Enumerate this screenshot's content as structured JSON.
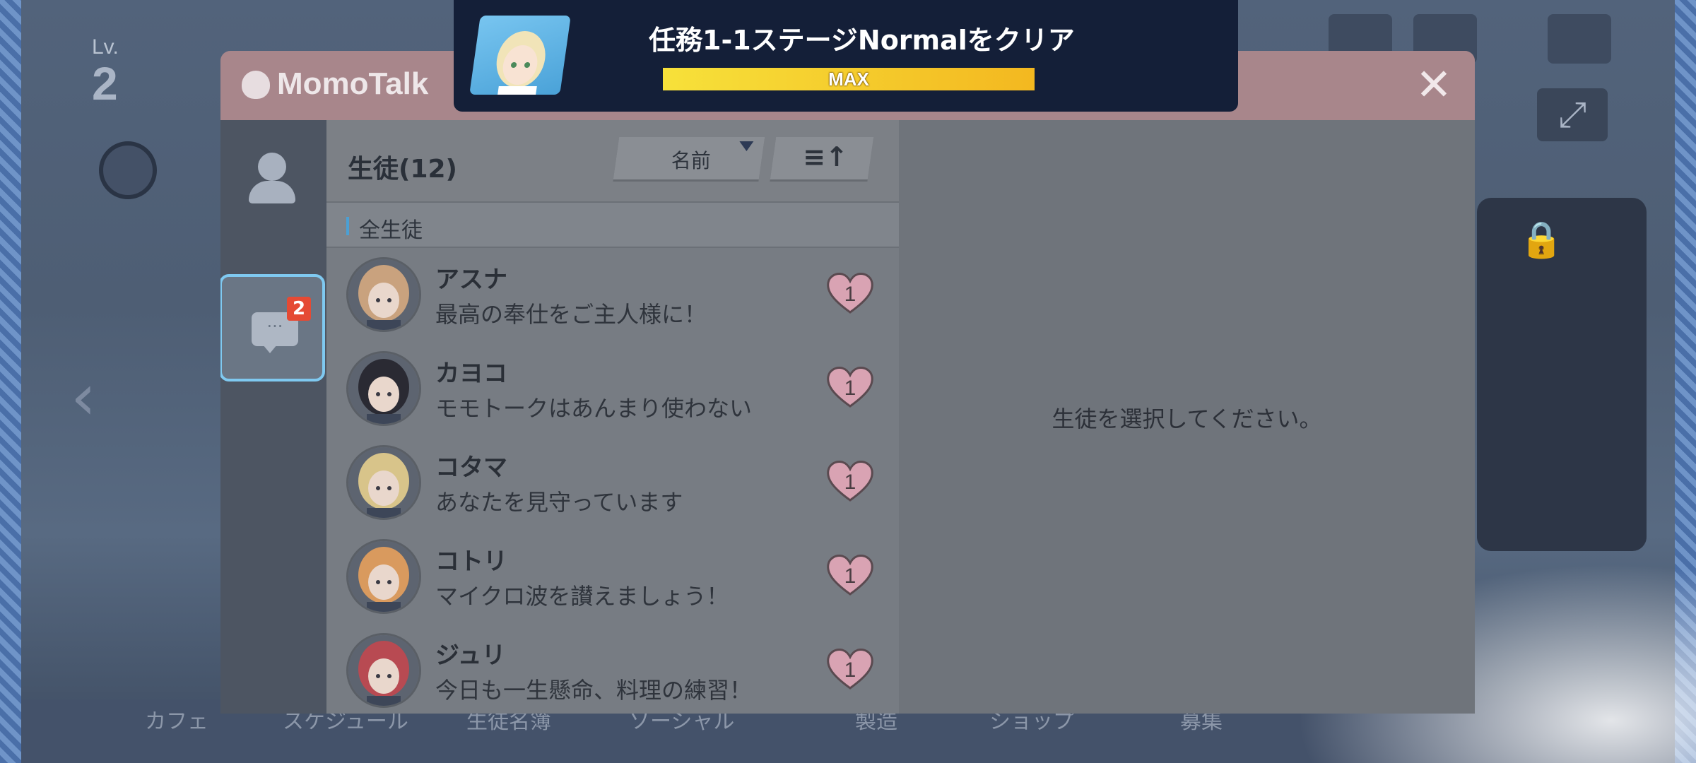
{
  "background": {
    "level_label": "Lv.",
    "level_value": "2",
    "nav": [
      "カフェ",
      "スケジュール",
      "生徒名簿",
      "ソーシャル",
      "製造",
      "ショップ",
      "募集"
    ]
  },
  "notification": {
    "title": "任務1-1ステージNormalをクリア",
    "progress_label": "MAX",
    "progress": 1.0
  },
  "momotalk": {
    "title": "MomoTalk",
    "sidebar": {
      "unread_badge": "2"
    },
    "list": {
      "title": "生徒(12)",
      "sort_label": "名前",
      "category": "全生徒",
      "students": [
        {
          "name": "アスナ",
          "message": "最高の奉仕をご主人様に！",
          "unread": "1",
          "hair": "#c9a27e"
        },
        {
          "name": "カヨコ",
          "message": "モモトークはあんまり使わない",
          "unread": "1",
          "hair": "#2a2a33"
        },
        {
          "name": "コタマ",
          "message": "あなたを見守っています",
          "unread": "1",
          "hair": "#d8c48a"
        },
        {
          "name": "コトリ",
          "message": "マイクロ波を讃えましょう！",
          "unread": "1",
          "hair": "#d99a5e"
        },
        {
          "name": "ジュリ",
          "message": "今日も一生懸命、料理の練習！",
          "unread": "1",
          "hair": "#b84a52"
        }
      ]
    },
    "detail": {
      "empty_text": "生徒を選択してください。"
    }
  },
  "colors": {
    "header": "#a8868b",
    "badge": "#e54a34",
    "selected_border": "#7fc9f0",
    "heart": "#d9a3b3",
    "progress": "#f3c82a"
  }
}
